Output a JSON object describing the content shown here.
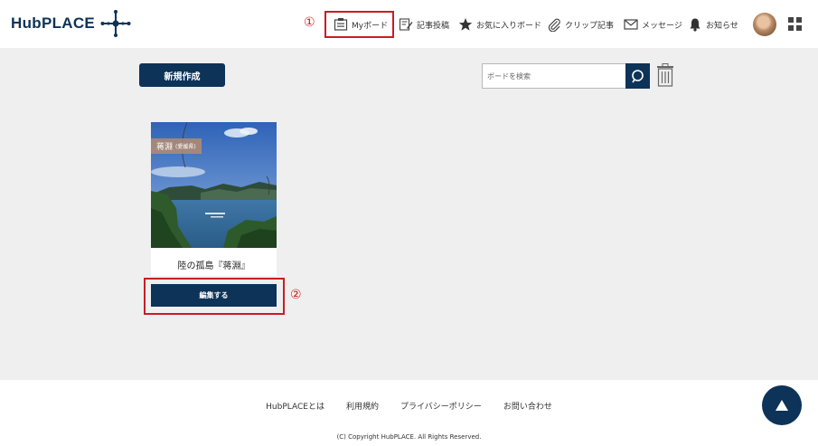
{
  "header": {
    "logo": "HubPLACE",
    "nav": [
      {
        "label": "Myボード",
        "icon": "board-icon"
      },
      {
        "label": "記事投稿",
        "icon": "edit-post-icon"
      },
      {
        "label": "お気に入りボード",
        "icon": "star-icon"
      },
      {
        "label": "クリップ記事",
        "icon": "paperclip-icon"
      },
      {
        "label": "メッセージ",
        "icon": "envelope-icon"
      },
      {
        "label": "お知らせ",
        "icon": "bell-icon"
      }
    ],
    "markers": {
      "one": "①",
      "two": "②"
    },
    "highlight_color": "#c81d25"
  },
  "toolbar": {
    "new_button": "新規作成",
    "search_placeholder": "ボードを検索"
  },
  "board": {
    "tag_main": "蒋淵",
    "tag_sub": "(愛媛県)",
    "title": "陸の孤島『蒋淵』",
    "edit_button": "編集する"
  },
  "footer": {
    "links": [
      "HubPLACEとは",
      "利用規約",
      "プライバシーポリシー",
      "お問い合わせ"
    ],
    "copyright": "(C) Copyright HubPLACE. All Rights Reserved."
  },
  "colors": {
    "brand": "#0d3358",
    "background": "#efefef",
    "annotation": "#c81d25"
  }
}
